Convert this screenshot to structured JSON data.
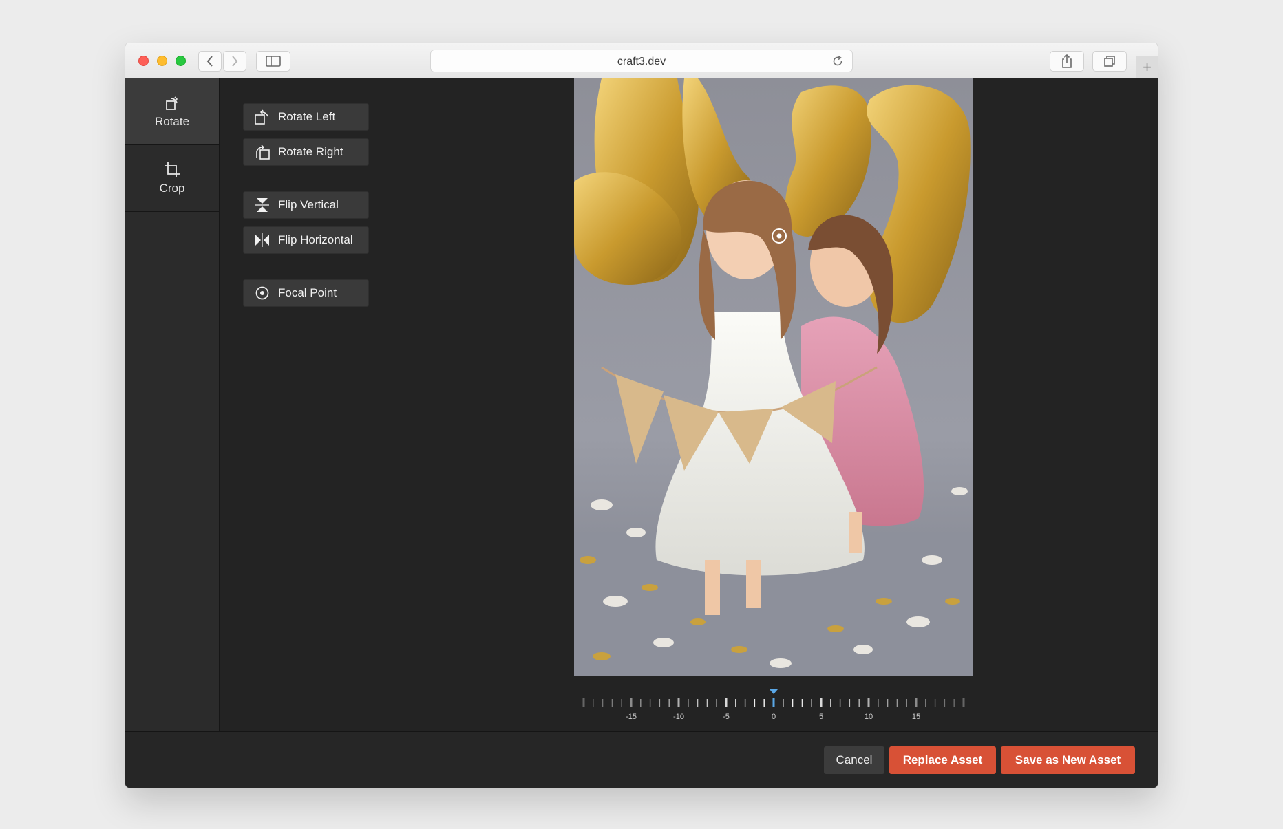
{
  "browser": {
    "url": "craft3.dev",
    "reload_icon": "reload-icon",
    "back_icon": "chevron-left-icon",
    "forward_icon": "chevron-right-icon",
    "sidebar_toggle_icon": "sidebar-icon",
    "share_icon": "share-icon",
    "tabs_icon": "tabs-icon",
    "new_tab_label": "+"
  },
  "sidebar": {
    "items": [
      {
        "label": "Rotate",
        "icon": "rotate-icon",
        "active": true
      },
      {
        "label": "Crop",
        "icon": "crop-icon",
        "active": false
      }
    ]
  },
  "tools": {
    "rotate_left": {
      "label": "Rotate Left",
      "icon": "rotate-left-icon"
    },
    "rotate_right": {
      "label": "Rotate Right",
      "icon": "rotate-right-icon"
    },
    "flip_vertical": {
      "label": "Flip Vertical",
      "icon": "flip-vertical-icon"
    },
    "flip_horizontal": {
      "label": "Flip Horizontal",
      "icon": "flip-horizontal-icon"
    },
    "focal_point": {
      "label": "Focal Point",
      "icon": "focal-point-icon"
    }
  },
  "image": {
    "focal_marker_icon": "focal-point-marker-icon"
  },
  "ruler": {
    "labels": [
      "-15",
      "-10",
      "-5",
      "0",
      "5",
      "10",
      "15"
    ],
    "current_value": 0,
    "min": -20,
    "max": 20
  },
  "footer": {
    "cancel_label": "Cancel",
    "replace_label": "Replace Asset",
    "save_new_label": "Save as New Asset"
  },
  "colors": {
    "accent": "#d85136",
    "indicator": "#5aa7e6",
    "panel": "#232323"
  }
}
